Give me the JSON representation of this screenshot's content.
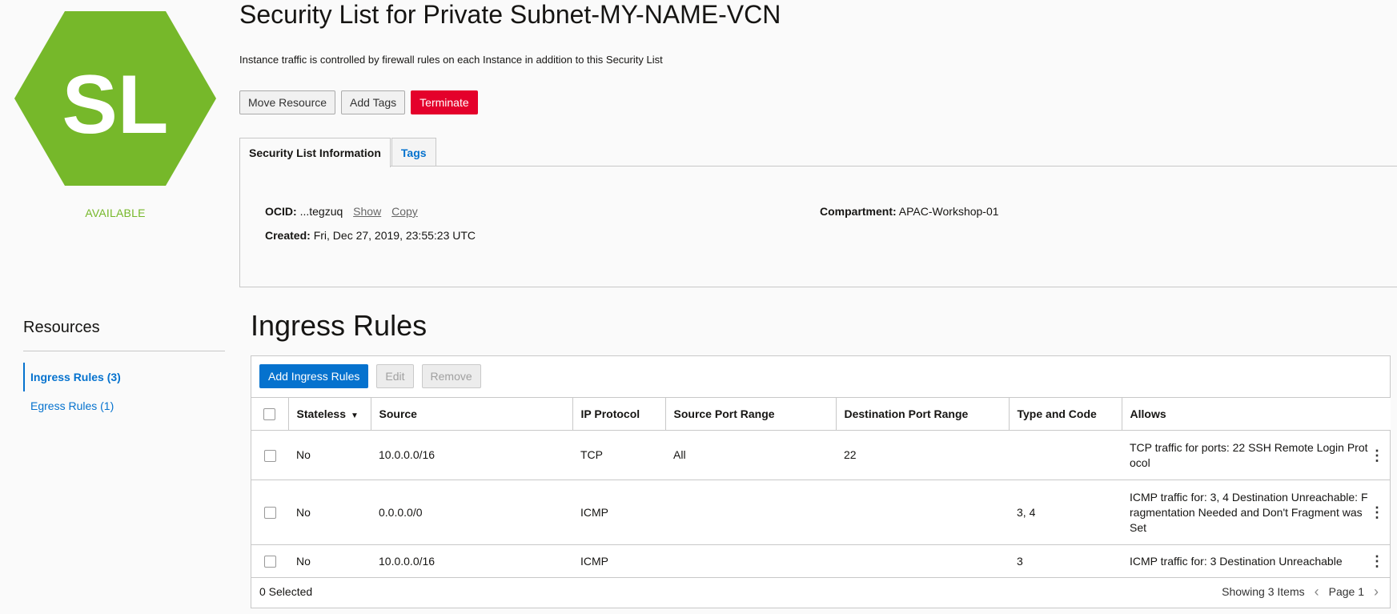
{
  "badge": {
    "text": "SL",
    "color": "#76b82a",
    "status": "AVAILABLE"
  },
  "header": {
    "title": "Security List for Private Subnet-MY-NAME-VCN",
    "subtitle": "Instance traffic is controlled by firewall rules on each Instance in addition to this Security List"
  },
  "actions": {
    "move": "Move Resource",
    "add_tags": "Add Tags",
    "terminate": "Terminate"
  },
  "tabs": [
    {
      "label": "Security List Information",
      "active": true
    },
    {
      "label": "Tags",
      "active": false
    }
  ],
  "info": {
    "ocid_label": "OCID:",
    "ocid_value": "...tegzuq",
    "show": "Show",
    "copy": "Copy",
    "created_label": "Created:",
    "created_value": "Fri, Dec 27, 2019, 23:55:23 UTC",
    "compartment_label": "Compartment:",
    "compartment_value": "APAC-Workshop-01"
  },
  "resources": {
    "title": "Resources",
    "items": [
      {
        "label": "Ingress Rules (3)",
        "active": true
      },
      {
        "label": "Egress Rules (1)",
        "active": false
      }
    ]
  },
  "ingress": {
    "title": "Ingress Rules",
    "add_button": "Add Ingress Rules",
    "edit_button": "Edit",
    "remove_button": "Remove",
    "columns": [
      "Stateless",
      "Source",
      "IP Protocol",
      "Source Port Range",
      "Destination Port Range",
      "Type and Code",
      "Allows"
    ],
    "rows": [
      {
        "stateless": "No",
        "source": "10.0.0.0/16",
        "protocol": "TCP",
        "src_port": "All",
        "dst_port": "22",
        "type_code": "",
        "allows": "TCP traffic for ports: 22 SSH Remote Login Protocol"
      },
      {
        "stateless": "No",
        "source": "0.0.0.0/0",
        "protocol": "ICMP",
        "src_port": "",
        "dst_port": "",
        "type_code": "3, 4",
        "allows": "ICMP traffic for: 3, 4 Destination Unreachable: Fragmentation Needed and Don't Fragment was Set"
      },
      {
        "stateless": "No",
        "source": "10.0.0.0/16",
        "protocol": "ICMP",
        "src_port": "",
        "dst_port": "",
        "type_code": "3",
        "allows": "ICMP traffic for: 3 Destination Unreachable"
      }
    ],
    "selected": "0 Selected",
    "showing": "Showing 3 Items",
    "page": "Page 1"
  }
}
